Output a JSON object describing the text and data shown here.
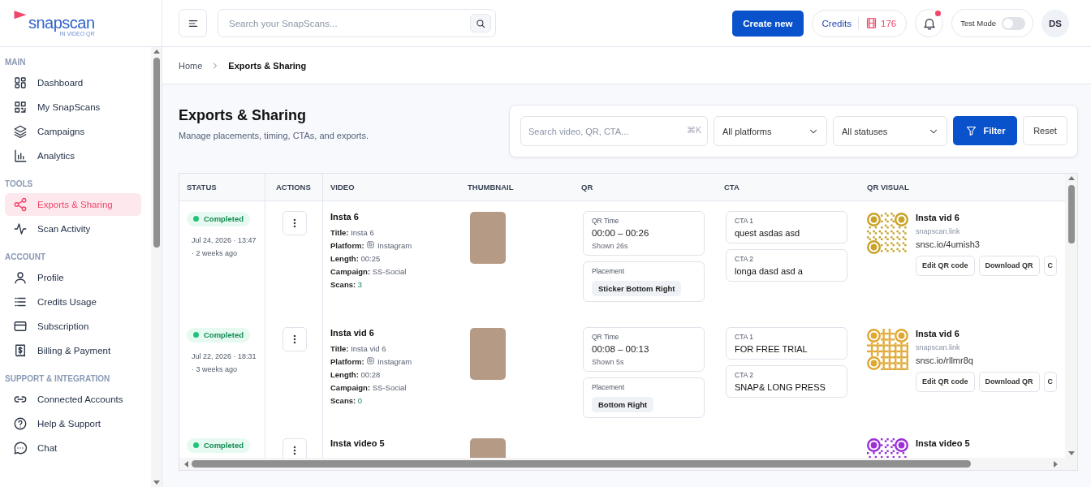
{
  "logo": {
    "name": "snapscan",
    "tagline": "IN VIDEO QR"
  },
  "sidebar": {
    "sections": [
      {
        "title": "MAIN",
        "items": [
          {
            "label": "Dashboard",
            "selected": false
          },
          {
            "label": "My SnapScans",
            "selected": false
          },
          {
            "label": "Campaigns",
            "selected": false
          },
          {
            "label": "Analytics",
            "selected": false
          }
        ]
      },
      {
        "title": "TOOLS",
        "items": [
          {
            "label": "Exports & Sharing",
            "selected": true
          },
          {
            "label": "Scan Activity",
            "selected": false
          }
        ]
      },
      {
        "title": "ACCOUNT",
        "items": [
          {
            "label": "Profile",
            "selected": false
          },
          {
            "label": "Credits Usage",
            "selected": false
          },
          {
            "label": "Subscription",
            "selected": false
          },
          {
            "label": "Billing & Payment",
            "selected": false
          }
        ]
      },
      {
        "title": "SUPPORT & INTEGRATION",
        "items": [
          {
            "label": "Connected Accounts",
            "selected": false
          },
          {
            "label": "Help & Support",
            "selected": false
          },
          {
            "label": "Chat",
            "selected": false
          }
        ]
      }
    ]
  },
  "header": {
    "search": {
      "placeholder": "Search your SnapScans..."
    },
    "create_button": "Create new",
    "credits": {
      "label": "Credits",
      "count": "176"
    },
    "notifications": {
      "unread": true
    },
    "test_mode": {
      "label": "Test Mode",
      "on": false
    },
    "avatar": "DS"
  },
  "breadcrumb": [
    "Home",
    "Exports & Sharing"
  ],
  "page": {
    "title": "Exports & Sharing",
    "subtitle": "Manage placements, timing, CTAs, and exports."
  },
  "filters": {
    "search": {
      "placeholder": "Search video, QR, CTA...",
      "shortcut": "⌘K"
    },
    "platform": "All platforms",
    "status": "All statuses",
    "filter_button": "Filter",
    "reset_button": "Reset"
  },
  "table": {
    "columns": [
      "STATUS",
      "ACTIONS",
      "VIDEO",
      "THUMBNAIL",
      "QR",
      "CTA",
      "QR VISUAL"
    ],
    "rows": [
      {
        "status": {
          "label": "Completed",
          "kind": "completed"
        },
        "date": "Jul 24, 2026 · 13:47",
        "ago": "· 2 weeks ago",
        "video": {
          "name": "Insta 6",
          "fields": [
            {
              "label": "Title:",
              "value": "Insta 6",
              "kind": "text"
            },
            {
              "label": "Platform:",
              "value": "Instagram",
              "kind": "platform"
            },
            {
              "label": "Length:",
              "value": "00:25",
              "kind": "text"
            },
            {
              "label": "Campaign:",
              "value": "SS-Social",
              "kind": "text"
            },
            {
              "label": "Scans:",
              "value": "3",
              "kind": "scans"
            }
          ]
        },
        "qr": {
          "time_label": "QR Time",
          "time": "00:00 – 00:26",
          "shown": "Shown 26s",
          "placement_label": "Placement",
          "placement": "Sticker Bottom Right"
        },
        "ctas": [
          {
            "label": "CTA 1",
            "text": "quest asdas asd"
          },
          {
            "label": "CTA 2",
            "text": "longa dasd asd a"
          }
        ],
        "qr_visual": {
          "color": "#c9a227",
          "name": "Insta vid 6",
          "domain": "snapscan.link",
          "short_url": "snsc.io/4umish3",
          "buttons": [
            "Edit QR code",
            "Download QR",
            "C"
          ]
        }
      },
      {
        "status": {
          "label": "Completed",
          "kind": "completed"
        },
        "date": "Jul 22, 2026 · 18:31",
        "ago": "· 3 weeks ago",
        "video": {
          "name": "Insta vid 6",
          "fields": [
            {
              "label": "Title:",
              "value": "Insta vid 6",
              "kind": "text"
            },
            {
              "label": "Platform:",
              "value": "Instagram",
              "kind": "platform"
            },
            {
              "label": "Length:",
              "value": "00:28",
              "kind": "text"
            },
            {
              "label": "Campaign:",
              "value": "SS-Social",
              "kind": "text"
            },
            {
              "label": "Scans:",
              "value": "0",
              "kind": "scans"
            }
          ]
        },
        "qr": {
          "time_label": "QR Time",
          "time": "00:08 – 00:13",
          "shown": "Shown 5s",
          "placement_label": "Placement",
          "placement": "Bottom Right"
        },
        "ctas": [
          {
            "label": "CTA 1",
            "text": "FOR FREE TRIAL"
          },
          {
            "label": "CTA 2",
            "text": "SNAP& LONG PRESS"
          }
        ],
        "qr_visual": {
          "color": "#e0a830",
          "name": "Insta vid 6",
          "domain": "snapscan.link",
          "short_url": "snsc.io/rllmr8q",
          "buttons": [
            "Edit QR code",
            "Download QR",
            "C"
          ]
        }
      },
      {
        "status": {
          "label": "Completed",
          "kind": "completed"
        },
        "video": {
          "name": "Insta video 5"
        },
        "qr_visual": {
          "color": "#9b30d9",
          "name": "Insta video 5"
        }
      }
    ]
  }
}
